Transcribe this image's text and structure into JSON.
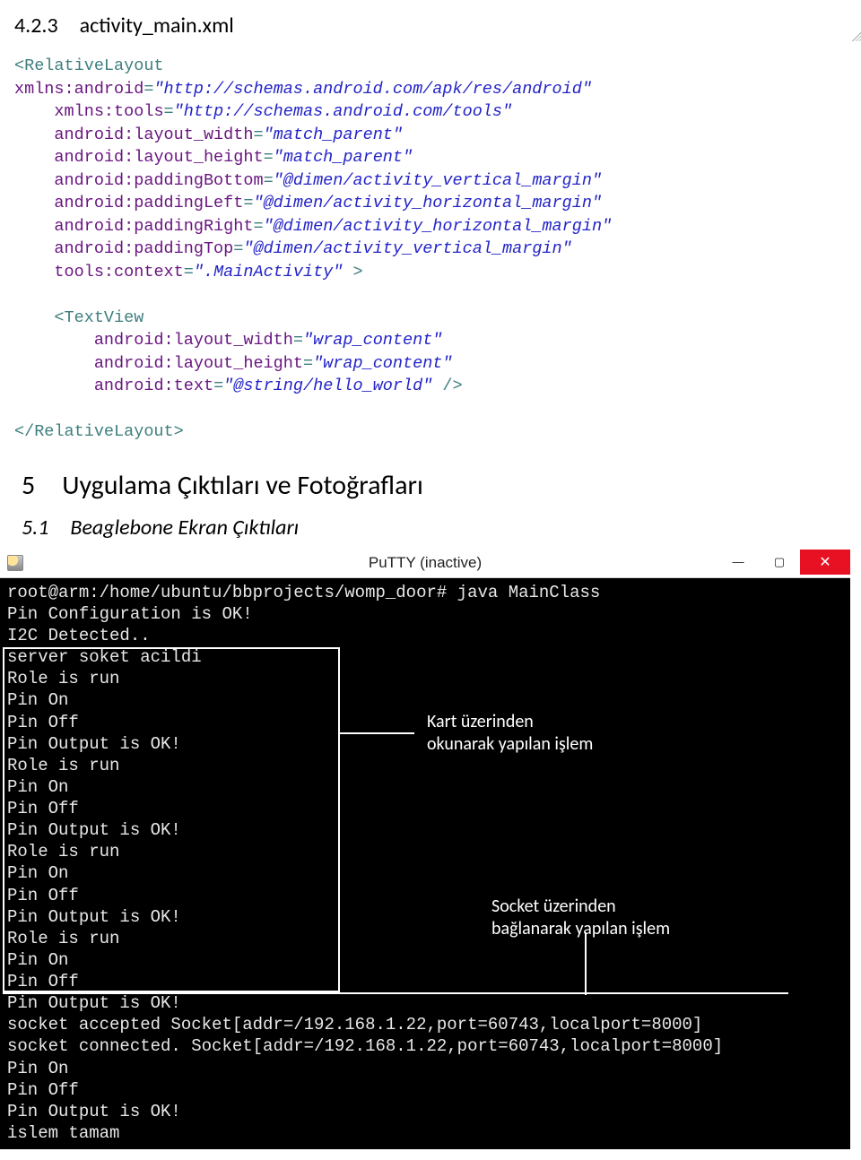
{
  "headings": {
    "h423": "4.2.3 activity_main.xml",
    "h5": "5 Uygulama Çıktıları ve Fotoğrafları",
    "h51": "5.1 Beaglebone Ekran Çıktıları"
  },
  "xml": {
    "l1a": "<RelativeLayout",
    "l2a": "xmlns:android",
    "l2v": "\"http://schemas.android.com/apk/res/android\"",
    "l3a": "xmlns:tools",
    "l3v": "\"http://schemas.android.com/tools\"",
    "l4a": "android:layout_width",
    "l4v": "\"match_parent\"",
    "l5a": "android:layout_height",
    "l5v": "\"match_parent\"",
    "l6a": "android:paddingBottom",
    "l6v": "\"@dimen/activity_vertical_margin\"",
    "l7a": "android:paddingLeft",
    "l7v": "\"@dimen/activity_horizontal_margin\"",
    "l8a": "android:paddingRight",
    "l8v": "\"@dimen/activity_horizontal_margin\"",
    "l9a": "android:paddingTop",
    "l9v": "\"@dimen/activity_vertical_margin\"",
    "l10a": "tools:context",
    "l10v": "\".MainActivity\"",
    "tv_open": "<TextView",
    "tv1a": "android:layout_width",
    "tv1v": "\"wrap_content\"",
    "tv2a": "android:layout_height",
    "tv2v": "\"wrap_content\"",
    "tv3a": "android:text",
    "tv3v": "\"@string/hello_world\"",
    "tv_close": "/>",
    "end": "</RelativeLayout>",
    "gt": ">",
    "eq": "="
  },
  "putty": {
    "title": "PuTTY (inactive)",
    "min_glyph": "—",
    "max_glyph": "▢",
    "close_glyph": "✕",
    "annot1_l1": "Kart üzerinden",
    "annot1_l2": "okunarak yapılan işlem",
    "annot2_l1": "Socket üzerinden",
    "annot2_l2": "bağlanarak yapılan işlem",
    "lines": {
      "p0": "root@arm:/home/ubuntu/bbprojects/womp_door# java MainClass",
      "p1": "Pin Configuration is OK!",
      "p2": "I2C Detected..",
      "p3": "server soket acildi",
      "r1": "Role is run",
      "on": "Pin On",
      "off": "Pin Off",
      "ok": "Pin Output is OK!",
      "sa": "socket accepted Socket[addr=/192.168.1.22,port=60743,localport=8000]",
      "sc": "socket connected. Socket[addr=/192.168.1.22,port=60743,localport=8000]",
      "it": "islem tamam"
    }
  }
}
